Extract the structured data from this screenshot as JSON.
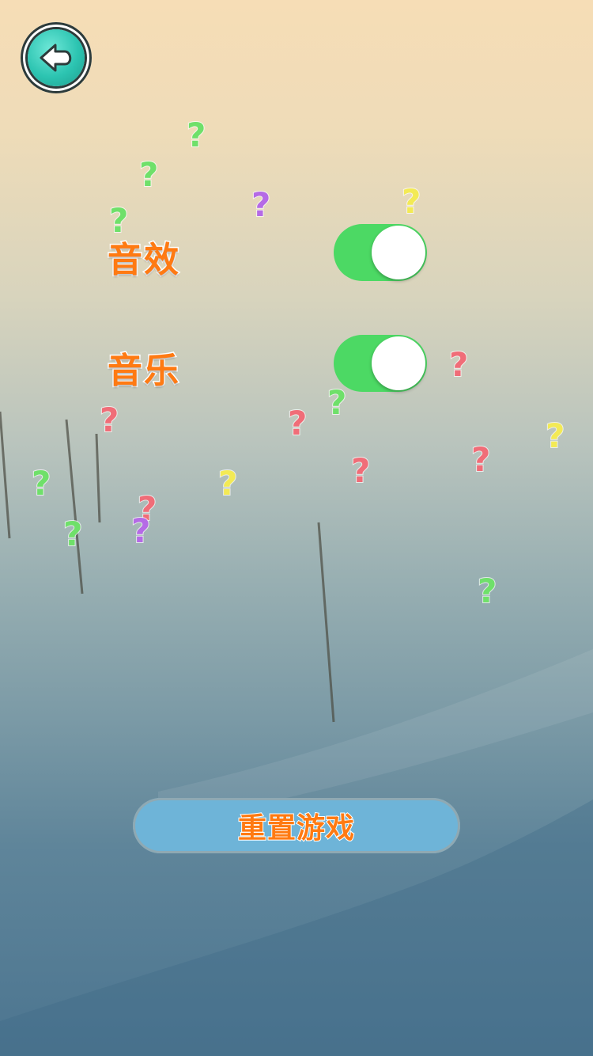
{
  "settings": {
    "sound_effects_label": "音效",
    "music_label": "音乐",
    "sound_effects_on": true,
    "music_on": true
  },
  "reset_button_label": "重置游戏",
  "colors": {
    "label_orange": "#ff7a12",
    "toggle_on": "#4cd964",
    "button_blue": "#6eb4d8",
    "back_teal": "#2cc4b1"
  },
  "decorations": {
    "question_mark": "?"
  }
}
